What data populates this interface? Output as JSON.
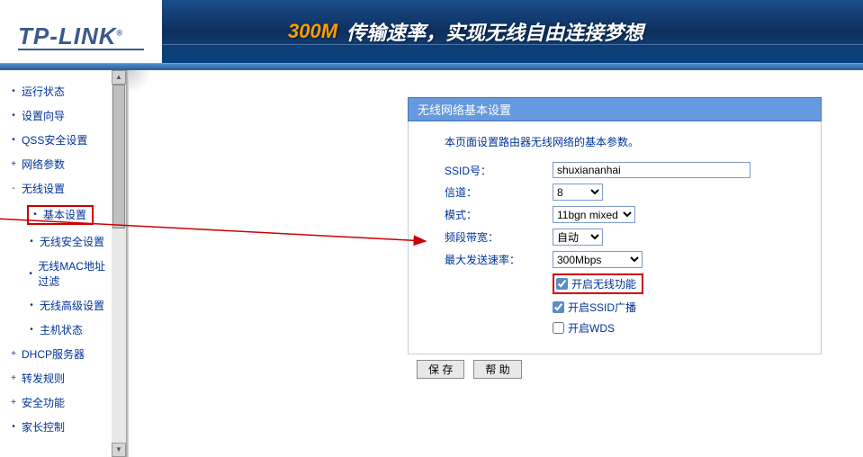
{
  "brand": {
    "logo": "TP-LINK",
    "registered": "®"
  },
  "banner": {
    "speed": "300M",
    "slogan": "传输速率，实现无线自由连接梦想"
  },
  "nav": {
    "items": [
      {
        "label": "运行状态",
        "bullet": "•",
        "sub": false
      },
      {
        "label": "设置向导",
        "bullet": "•",
        "sub": false
      },
      {
        "label": "QSS安全设置",
        "bullet": "•",
        "sub": false
      },
      {
        "label": "网络参数",
        "bullet": "+",
        "sub": false
      },
      {
        "label": "无线设置",
        "bullet": "-",
        "sub": false
      },
      {
        "label": "基本设置",
        "bullet": "•",
        "sub": true,
        "highlighted": true
      },
      {
        "label": "无线安全设置",
        "bullet": "•",
        "sub": true
      },
      {
        "label": "无线MAC地址过滤",
        "bullet": "•",
        "sub": true
      },
      {
        "label": "无线高级设置",
        "bullet": "•",
        "sub": true
      },
      {
        "label": "主机状态",
        "bullet": "•",
        "sub": true
      },
      {
        "label": "DHCP服务器",
        "bullet": "+",
        "sub": false
      },
      {
        "label": "转发规则",
        "bullet": "+",
        "sub": false
      },
      {
        "label": "安全功能",
        "bullet": "+",
        "sub": false
      },
      {
        "label": "家长控制",
        "bullet": "•",
        "sub": false
      }
    ]
  },
  "panel": {
    "title": "无线网络基本设置",
    "description": "本页面设置路由器无线网络的基本参数。",
    "form": {
      "ssid_label": "SSID号：",
      "ssid_value": "shuxiananhai",
      "channel_label": "信道：",
      "channel_value": "8",
      "mode_label": "模式：",
      "mode_value": "11bgn mixed",
      "bandwidth_label": "频段带宽：",
      "bandwidth_value": "自动",
      "maxrate_label": "最大发送速率：",
      "maxrate_value": "300Mbps"
    },
    "checkboxes": {
      "enable_wireless": "开启无线功能",
      "enable_broadcast": "开启SSID广播",
      "enable_wds": "开启WDS"
    },
    "buttons": {
      "save": "保 存",
      "help": "帮 助"
    }
  }
}
